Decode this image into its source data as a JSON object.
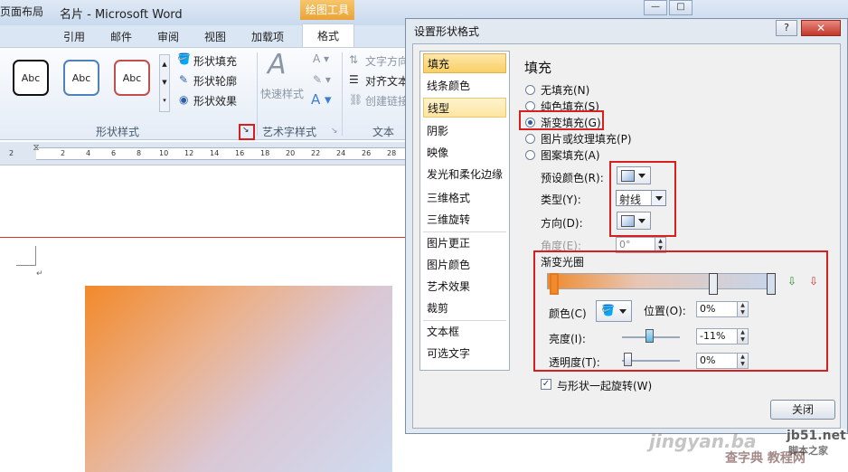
{
  "window": {
    "title": "名片 - Microsoft Word",
    "context_tab": "绘图工具",
    "controls": [
      "—",
      "□",
      "✕"
    ]
  },
  "tabs": [
    "页面布局",
    "引用",
    "邮件",
    "审阅",
    "视图",
    "加载项",
    "格式"
  ],
  "ribbon": {
    "shape_styles": {
      "samples": [
        "Abc",
        "Abc",
        "Abc"
      ],
      "fill": "形状填充",
      "outline": "形状轮廓",
      "effects": "形状效果",
      "group_label": "形状样式"
    },
    "wordart": {
      "quick_styles": "快速样式",
      "group_label": "艺术字样式"
    },
    "text": {
      "direction": "文字方向",
      "align": "对齐文本",
      "link": "创建链接",
      "group_label": "文本"
    }
  },
  "ruler": {
    "ticks": [
      "2",
      "2",
      "4",
      "6",
      "8",
      "10",
      "12",
      "14",
      "16",
      "18",
      "20",
      "22",
      "24",
      "26",
      "28"
    ]
  },
  "dialog": {
    "title": "设置形状格式",
    "help": "?",
    "close_x": "✕",
    "nav": [
      "填充",
      "线条颜色",
      "线型",
      "阴影",
      "映像",
      "发光和柔化边缘",
      "三维格式",
      "三维旋转",
      "图片更正",
      "图片颜色",
      "艺术效果",
      "裁剪",
      "文本框",
      "可选文字"
    ],
    "section_title": "填充",
    "fill_options": [
      {
        "label": "无填充(N)",
        "selected": false
      },
      {
        "label": "纯色填充(S)",
        "selected": false
      },
      {
        "label": "渐变填充(G)",
        "selected": true
      },
      {
        "label": "图片或纹理填充(P)",
        "selected": false
      },
      {
        "label": "图案填充(A)",
        "selected": false
      }
    ],
    "preset_colors_label": "预设颜色(R):",
    "type_label": "类型(Y):",
    "type_value": "射线",
    "direction_label": "方向(D):",
    "angle_label": "角度(E):",
    "angle_value": "0°",
    "gradient_stops_label": "渐变光圈",
    "color_label": "颜色(C)",
    "position_label": "位置(O):",
    "position_value": "0%",
    "brightness_label": "亮度(I):",
    "brightness_value": "-11%",
    "transparency_label": "透明度(T):",
    "transparency_value": "0%",
    "rotate_with_shape_label": "与形状一起旋转(W)",
    "rotate_with_shape_checked": true,
    "close_button": "关闭"
  },
  "watermarks": {
    "jingyan": "jingyan.ba",
    "jb51": "jb51.net",
    "jb51_sub": "脚本之家",
    "jiaocheng": "查字典 教程网"
  },
  "colors": {
    "highlight_red": "#d71f1f",
    "nav_selected": "#f9cf66",
    "gradient_start": "#f2892b",
    "gradient_end": "#cfdbf0"
  }
}
